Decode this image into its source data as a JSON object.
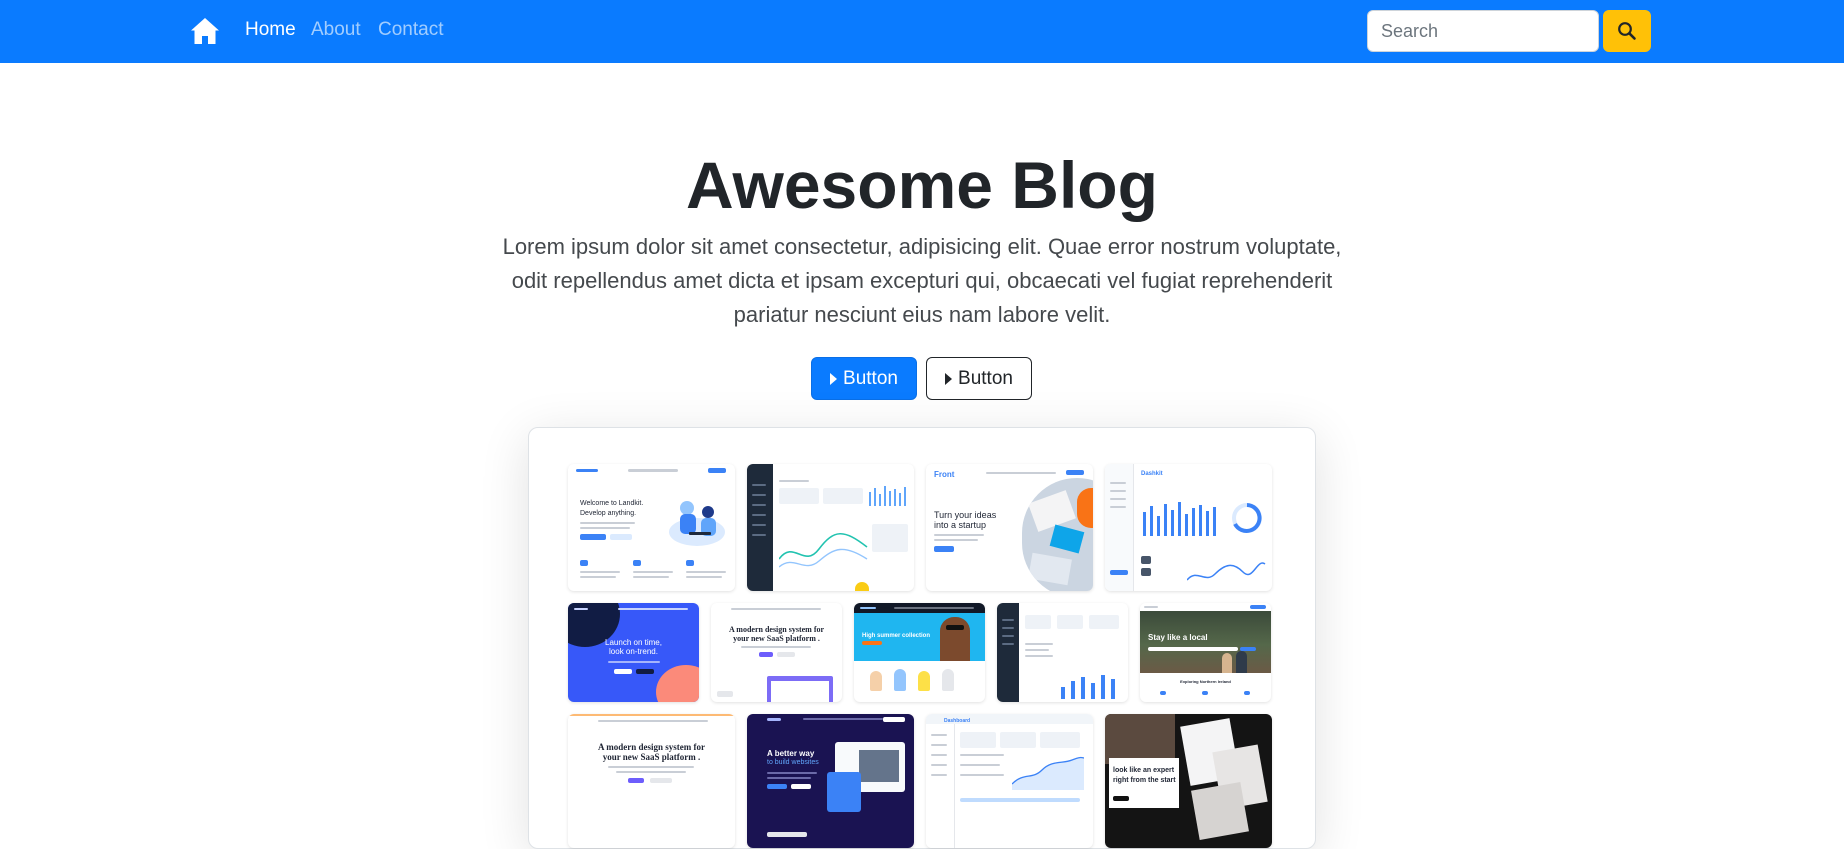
{
  "nav": {
    "links": [
      {
        "label": "Home",
        "active": true
      },
      {
        "label": "About",
        "active": false
      },
      {
        "label": "Contact",
        "active": false
      }
    ],
    "search": {
      "placeholder": "Search",
      "value": ""
    },
    "icons": {
      "home": "house-icon",
      "search": "search-icon"
    }
  },
  "hero": {
    "title": "Awesome Blog",
    "lead": "Lorem ipsum dolor sit amet consectetur, adipisicing elit. Quae error nostrum voluptate, odit repellendus amet dicta et ipsam excepturi qui, obcaecati vel fugiat reprehenderit pariatur nesciunt eius nam labore velit.",
    "primary_button": "Button",
    "secondary_button": "Button",
    "button_icon": "caret-right-icon"
  },
  "colors": {
    "navbar": "#0a7bff",
    "primary": "#0a7bff",
    "search_button": "#ffc107",
    "text": "#212529"
  },
  "showcase": {
    "thumbs": [
      {
        "name": "thumb-landkit",
        "texts": [
          "Welcome to Landkit.",
          "Develop anything."
        ]
      },
      {
        "name": "thumb-dashboard-dark",
        "texts": []
      },
      {
        "name": "thumb-front",
        "texts": [
          "Front",
          "Turn your ideas",
          "into a startup"
        ]
      },
      {
        "name": "thumb-dashboard-light",
        "texts": [
          "Dashkit"
        ]
      },
      {
        "name": "thumb-launch",
        "texts": [
          "Launch on time,",
          "look on-trend."
        ]
      },
      {
        "name": "thumb-saas",
        "texts": [
          "A modern design system for",
          "your new SaaS platform ."
        ]
      },
      {
        "name": "thumb-ecommerce",
        "texts": [
          "High summer collection"
        ]
      },
      {
        "name": "thumb-admin",
        "texts": []
      },
      {
        "name": "thumb-travel",
        "texts": [
          "Stay like a local",
          "Exploring Northern Ireland"
        ]
      },
      {
        "name": "thumb-saas-2",
        "texts": [
          "A modern design system for",
          "your new SaaS platform ."
        ]
      },
      {
        "name": "thumb-dark-startup",
        "texts": [
          "A better way",
          "to build websites"
        ]
      },
      {
        "name": "thumb-admin-2",
        "texts": [
          "Dashboard"
        ]
      },
      {
        "name": "thumb-expert",
        "texts": [
          "look like an expert",
          "right from the start"
        ]
      }
    ]
  }
}
